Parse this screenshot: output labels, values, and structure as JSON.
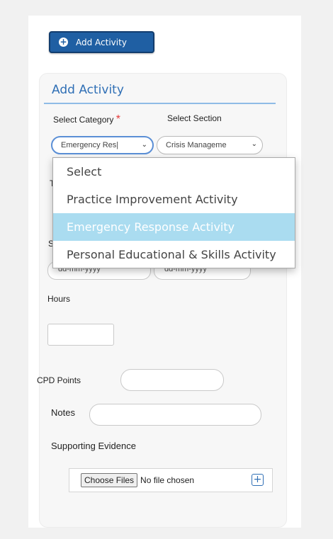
{
  "toolbar": {
    "add_activity_label": "Add Activity"
  },
  "form": {
    "title": "Add Activity",
    "select_category_label": "Select Category",
    "required_mark": "*",
    "select_section_label": "Select Section",
    "category_value": "Emergency Res|",
    "section_value": "Crisis Manageme",
    "date_start_placeholder": "dd-mm-yyyy",
    "date_end_placeholder": "dd-mm-yyyy",
    "hidden_label_initial": "S",
    "hidden_label_initial_2": "T",
    "hours_label": "Hours",
    "cpd_label": "CPD Points",
    "notes_label": "Notes",
    "evidence_label": "Supporting Evidence",
    "choose_files_label": "Choose Files",
    "no_file_text": "No file chosen"
  },
  "dropdown": {
    "options": [
      "Select",
      "Practice Improvement Activity",
      "Emergency Response Activity",
      "Personal Educational & Skills Activity"
    ],
    "highlighted_index": 2,
    "highlight_color": "#aadcf0"
  },
  "colors": {
    "accent": "#2f6fb5",
    "button": "#1f5fa3",
    "required": "#e43b3b"
  }
}
